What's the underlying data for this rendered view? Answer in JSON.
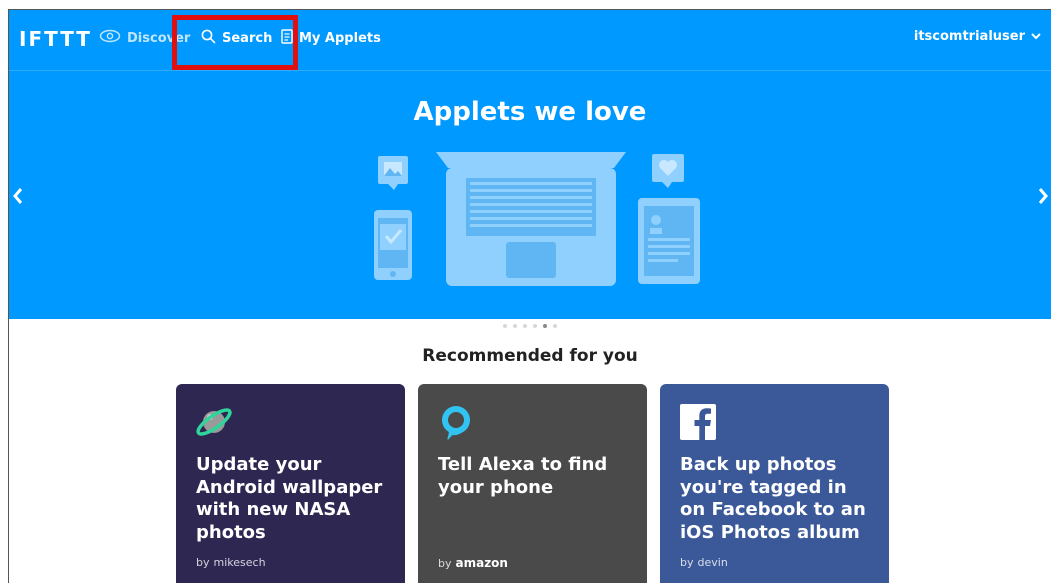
{
  "nav": {
    "logo": "IFTTT",
    "discover_label": "Discover",
    "search_label": "Search",
    "my_applets_label": "My Applets",
    "username": "itscomtrialuser"
  },
  "hero": {
    "title": "Applets we love",
    "carousel_count": 6,
    "carousel_active_index": 4
  },
  "recommended": {
    "title": "Recommended for you",
    "cards": [
      {
        "title": "Update your Android wallpaper with new NASA photos",
        "by_prefix": "by",
        "author": "mikesech",
        "icon": "planet-icon",
        "color": "#2d2752"
      },
      {
        "title": "Tell Alexa to find your phone",
        "by_prefix": "by",
        "author": "amazon",
        "icon": "alexa-icon",
        "color": "#4a4a4a"
      },
      {
        "title": "Back up photos you're tagged in on Facebook to an iOS Photos album",
        "by_prefix": "by",
        "author": "devin",
        "icon": "facebook-icon",
        "color": "#3b5998"
      }
    ]
  },
  "colors": {
    "hero_bg": "#0099ff",
    "highlight": "#e01010"
  }
}
